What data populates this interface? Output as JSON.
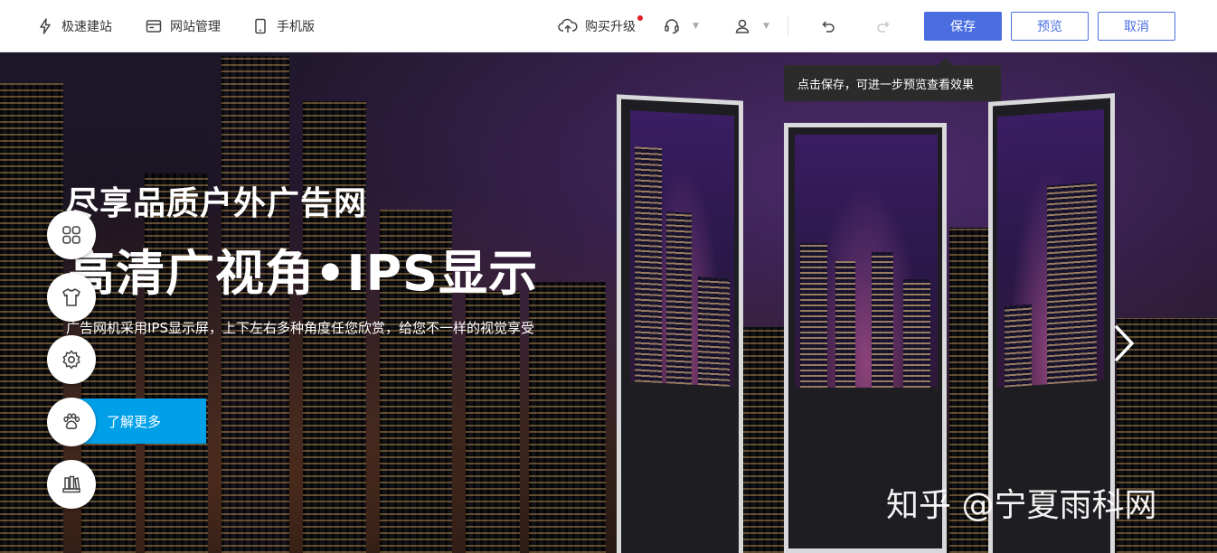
{
  "toolbar": {
    "quick_build": "极速建站",
    "site_manage": "网站管理",
    "mobile": "手机版",
    "upgrade": "购买升级",
    "save": "保存",
    "preview": "预览",
    "cancel": "取消"
  },
  "icons": {
    "quick_build": "lightning-icon",
    "site_manage": "site-manage-icon",
    "mobile": "mobile-icon",
    "upgrade": "cloud-upload-icon",
    "support": "headset-icon",
    "user": "user-icon",
    "undo": "undo-icon",
    "redo": "redo-icon"
  },
  "tooltip": {
    "text": "点击保存，可进一步预览查看效果"
  },
  "banner": {
    "title_small": "尽享品质户外广告网",
    "title_large": "高清广视角•IPS显示",
    "subtitle": "广告网机采用IPS显示屏，上下左右多种角度任您欣赏，给您不一样的视觉享受",
    "button": "了解更多"
  },
  "side_tools": [
    "grid-icon",
    "shirt-icon",
    "gear-icon",
    "paw-icon",
    "books-icon"
  ],
  "watermark": "知乎 @宁夏雨科网",
  "colors": {
    "primary": "#4a6ee0",
    "accent": "#00a0e9",
    "notification_dot": "#e02020"
  }
}
